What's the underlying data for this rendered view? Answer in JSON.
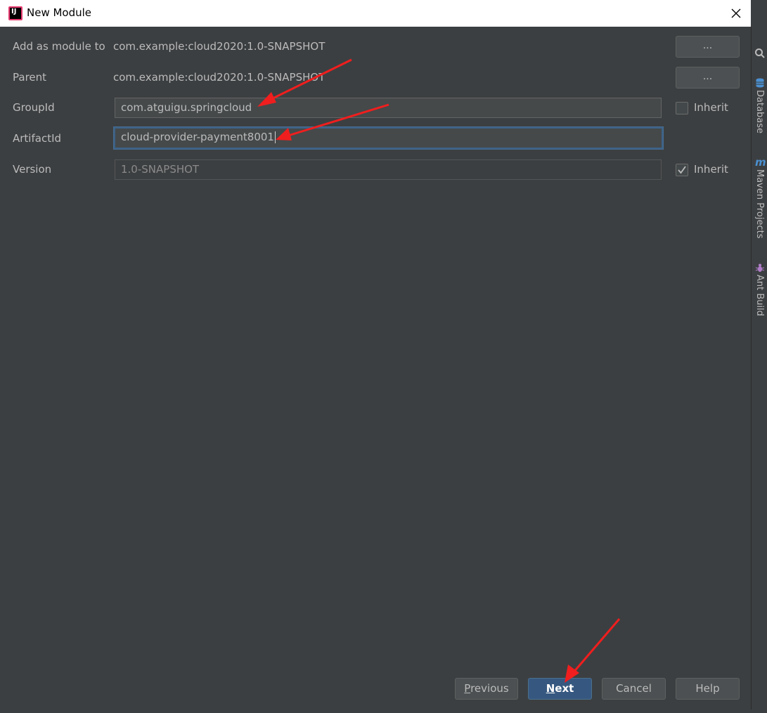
{
  "window": {
    "title": "New Module"
  },
  "form": {
    "add_as_module_label": "Add as module to",
    "add_as_module_value": "com.example:cloud2020:1.0-SNAPSHOT",
    "parent_label": "Parent",
    "parent_value": "com.example:cloud2020:1.0-SNAPSHOT",
    "browse_label": "...",
    "groupid_label": "GroupId",
    "groupid_value": "com.atguigu.springcloud",
    "artifactid_label": "ArtifactId",
    "artifactid_value": "cloud-provider-payment8001",
    "version_label": "Version",
    "version_value": "1.0-SNAPSHOT",
    "inherit_label": "Inherit",
    "groupid_inherit_checked": false,
    "version_inherit_checked": true
  },
  "buttons": {
    "previous_mnemonic": "P",
    "previous_rest": "revious",
    "next_mnemonic": "N",
    "next_rest": "ext",
    "cancel": "Cancel",
    "help": "Help"
  },
  "side_tools": {
    "database": "Database",
    "maven": "Maven Projects",
    "ant": "Ant Build"
  },
  "colors": {
    "dialog_bg": "#3c3f41",
    "primary_button": "#365880",
    "annotation_arrow": "#f01e1e"
  }
}
